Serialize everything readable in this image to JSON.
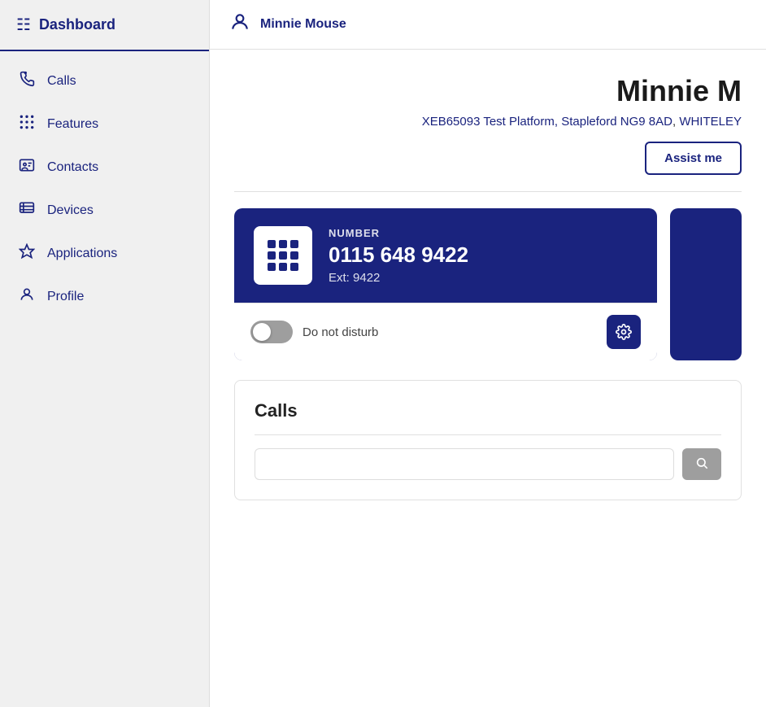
{
  "sidebar": {
    "header": {
      "label": "Dashboard",
      "icon": "⊞"
    },
    "items": [
      {
        "id": "calls",
        "label": "Calls",
        "icon": "📞"
      },
      {
        "id": "features",
        "label": "Features",
        "icon": "⠿"
      },
      {
        "id": "contacts",
        "label": "Contacts",
        "icon": "🪪"
      },
      {
        "id": "devices",
        "label": "Devices",
        "icon": "📋"
      },
      {
        "id": "applications",
        "label": "Applications",
        "icon": "◈"
      },
      {
        "id": "profile",
        "label": "Profile",
        "icon": "👤"
      }
    ]
  },
  "topbar": {
    "username": "Minnie Mouse",
    "user_icon": "👤"
  },
  "profile": {
    "name": "Minnie M",
    "platform_id": "XEB65093",
    "platform_name": "Test Platform",
    "platform_address": "Stapleford NG9 8AD",
    "platform_location": "WHITELEY",
    "assist_label": "Assist me"
  },
  "number_card": {
    "label": "NUMBER",
    "number": "0115 648 9422",
    "ext_label": "Ext: 9422",
    "dnd_label": "Do not disturb",
    "dnd_active": false
  },
  "calls_section": {
    "title": "Calls",
    "search_placeholder": ""
  }
}
